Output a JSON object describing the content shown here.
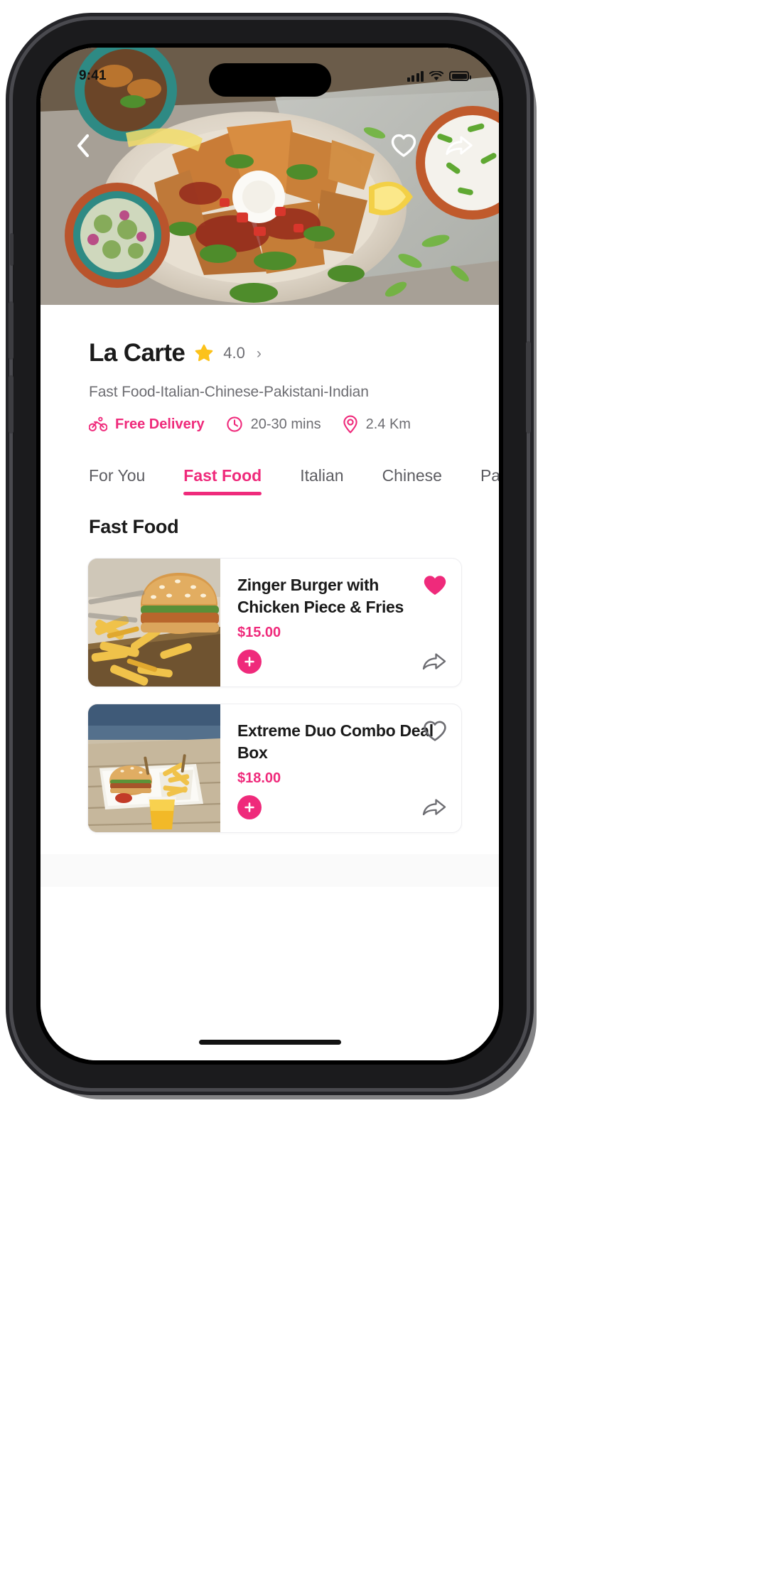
{
  "status_bar": {
    "time": "9:41",
    "signal_icon": "cellular-bars-icon",
    "wifi_icon": "wifi-icon",
    "battery_icon": "battery-icon"
  },
  "hero": {
    "back_icon": "back-chevron-icon",
    "favorite_icon": "heart-outline-icon",
    "share_icon": "share-arrow-icon",
    "image_alt": "loaded-fries-platter-photo"
  },
  "restaurant": {
    "name": "La Carte",
    "star_icon": "star-icon",
    "rating": "4.0",
    "rating_chevron_icon": "chevron-right-icon",
    "cuisines": "Fast Food-Italian-Chinese-Pakistani-Indian",
    "meta": [
      {
        "icon": "bicycle-icon",
        "text": "Free Delivery",
        "accent": true
      },
      {
        "icon": "clock-icon",
        "text": "20-30 mins",
        "accent": false
      },
      {
        "icon": "location-pin-icon",
        "text": "2.4 Km",
        "accent": false
      }
    ]
  },
  "tabs": [
    {
      "label": "For You",
      "active": false
    },
    {
      "label": "Fast Food",
      "active": true
    },
    {
      "label": "Italian",
      "active": false
    },
    {
      "label": "Chinese",
      "active": false
    },
    {
      "label": "Paki",
      "active": false
    }
  ],
  "section": {
    "title": "Fast Food"
  },
  "menu_items": [
    {
      "name": "Zinger Burger with Chicken Piece & Fries",
      "price": "$15.00",
      "favorited": true,
      "favorite_icon": "heart-filled-icon",
      "add_icon": "plus-icon",
      "share_icon": "share-arrow-icon",
      "thumb_alt": "zinger-burger-and-fries-photo"
    },
    {
      "name": "Extreme Duo Combo Deal Box",
      "price": "$18.00",
      "favorited": false,
      "favorite_icon": "heart-outline-icon",
      "add_icon": "plus-icon",
      "share_icon": "share-arrow-icon",
      "thumb_alt": "duo-burger-combo-photo"
    }
  ],
  "colors": {
    "accent": "#ef2a7b",
    "star": "#fcc21b",
    "text_primary": "#1a1a1a",
    "text_secondary": "#6d6d72"
  },
  "home_indicator": "home-indicator"
}
